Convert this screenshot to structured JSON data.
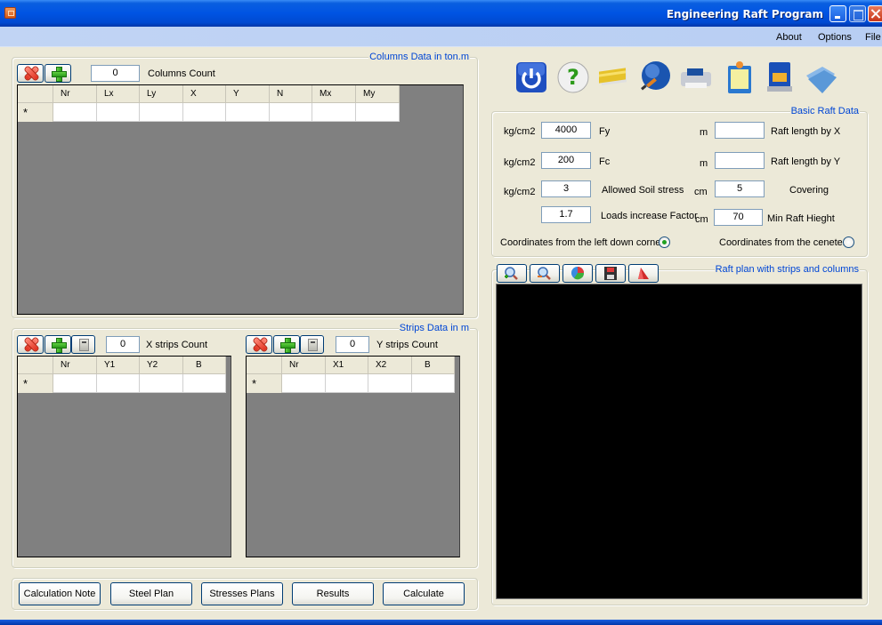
{
  "window": {
    "title": "Engineering Raft Program",
    "controls": [
      "minimize",
      "maximize",
      "close"
    ]
  },
  "menubar": {
    "items": [
      "About",
      "Options",
      "File"
    ]
  },
  "columns_panel": {
    "title": "Columns Data in ton.m",
    "count_value": "0",
    "count_label": "Columns Count",
    "headers": [
      "Nr",
      "Lx",
      "Ly",
      "X",
      "Y",
      "N",
      "Mx",
      "My"
    ],
    "new_row_marker": "*"
  },
  "toolbar_icons": [
    "power-icon",
    "help-icon",
    "card-icon",
    "globe-brush-icon",
    "printer-icon",
    "notepad-icon",
    "floppy-save-icon",
    "folder-open-icon"
  ],
  "basic_raft": {
    "title": "Basic Raft Data",
    "fy": {
      "unit": "kg/cm2",
      "value": "4000",
      "label": "Fy"
    },
    "fc": {
      "unit": "kg/cm2",
      "value": "200",
      "label": "Fc"
    },
    "soil": {
      "unit": "kg/cm2",
      "value": "3",
      "label": "Allowed Soil stress"
    },
    "loads": {
      "value": "1.7",
      "label": "Loads increase Factor"
    },
    "length_x": {
      "unit": "m",
      "value": "",
      "label": "Raft length by X"
    },
    "length_y": {
      "unit": "m",
      "value": "",
      "label": "Raft length by Y"
    },
    "covering": {
      "unit": "cm",
      "value": "5",
      "label": "Covering"
    },
    "min_height": {
      "unit": "cm",
      "value": "70",
      "label": "Min Raft Hieght"
    },
    "radio_left": {
      "label": "Coordinates from the left down corner",
      "checked": true
    },
    "radio_center": {
      "label": "Coordinates from the ceneter",
      "checked": false
    }
  },
  "strips_panel": {
    "title": "Strips Data in m",
    "x": {
      "count_value": "0",
      "count_label": "X strips Count",
      "headers": [
        "Nr",
        "Y1",
        "Y2",
        "B"
      ]
    },
    "y": {
      "count_value": "0",
      "count_label": "Y strips Count",
      "headers": [
        "Nr",
        "X1",
        "X2",
        "B"
      ]
    },
    "new_row_marker": "*"
  },
  "plan_panel": {
    "title": "Raft plan with strips and columns",
    "tools": [
      "zoom-in-icon",
      "zoom-out-icon",
      "pie-color-icon",
      "save-icon",
      "red-shape-icon"
    ]
  },
  "actions": [
    "Calculation Note",
    "Steel Plan",
    "Stresses Plans",
    "Results",
    "Calculate"
  ]
}
